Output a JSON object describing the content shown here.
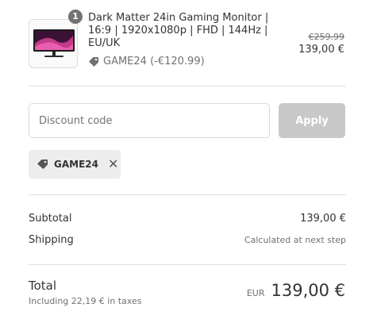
{
  "product": {
    "quantity": "1",
    "name": "Dark Matter 24in Gaming Monitor | 16:9 | 1920x1080p | FHD | 144Hz | EU/UK",
    "discount_line": "GAME24 (-€120.99)",
    "price_original": "€259.99",
    "price_final": "139,00 €"
  },
  "discount": {
    "placeholder": "Discount code",
    "apply_label": "Apply",
    "applied_code": "GAME24",
    "remove_symbol": "✕"
  },
  "summary": {
    "subtotal_label": "Subtotal",
    "subtotal_value": "139,00 €",
    "shipping_label": "Shipping",
    "shipping_value": "Calculated at next step",
    "total_label": "Total",
    "taxes_note": "Including 22,19 € in taxes",
    "currency": "EUR",
    "total_value": "139,00 €"
  },
  "colors": {
    "apply_button_disabled": "#c8c8c8",
    "chip_background": "#ededed",
    "badge": "#737373"
  },
  "icons": {
    "tag": "tag-icon",
    "remove": "close-icon"
  }
}
